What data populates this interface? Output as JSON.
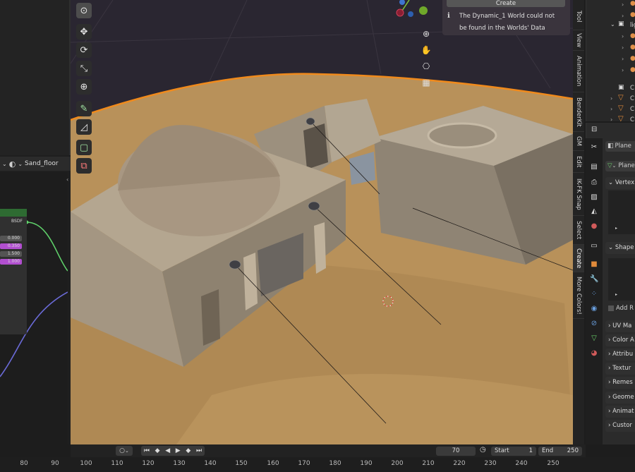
{
  "node_editor": {
    "world_icon": "world-icon",
    "world_name": "Sand_floor",
    "socket_label": "BSDF",
    "values": [
      "0.000",
      "0.350",
      "1.500",
      "1.000"
    ]
  },
  "viewport": {
    "notification": {
      "create_label": "Create",
      "message_line1": "The Dynamic_1 World could not",
      "message_line2": "be found in the Worlds' Data"
    }
  },
  "n_panel_tabs": [
    "Tool",
    "View",
    "Animation",
    "BenderKit",
    "GM",
    "Edit",
    "IK-FK Snap",
    "Select",
    "Create",
    "More Colors!"
  ],
  "properties": {
    "object_name": "Plane",
    "data_name": "Plane",
    "panels": [
      "Vertex",
      "Shape",
      "Add R",
      "UV Ma",
      "Color A",
      "Attribu",
      "Textur",
      "Remes",
      "Geome",
      "Animat",
      "Custor"
    ]
  },
  "outliner": {
    "collection_label": "lig",
    "items": [
      "C",
      "C",
      "C",
      "C"
    ]
  },
  "timeline": {
    "current_frame": "70",
    "start_label": "Start",
    "start_value": "1",
    "end_label": "End",
    "end_value": "250",
    "ruler": [
      "80",
      "90",
      "100",
      "110",
      "120",
      "130",
      "140",
      "150",
      "160",
      "170",
      "180",
      "190",
      "200",
      "210",
      "220",
      "230",
      "240",
      "250"
    ]
  },
  "colors": {
    "sand": "#b8915a",
    "sky": "#2a2631",
    "stone": "#a89a88",
    "horizon_outline": "#f08a1c",
    "node_green": "#2e6b32",
    "value_purple": "#b24fd0"
  }
}
